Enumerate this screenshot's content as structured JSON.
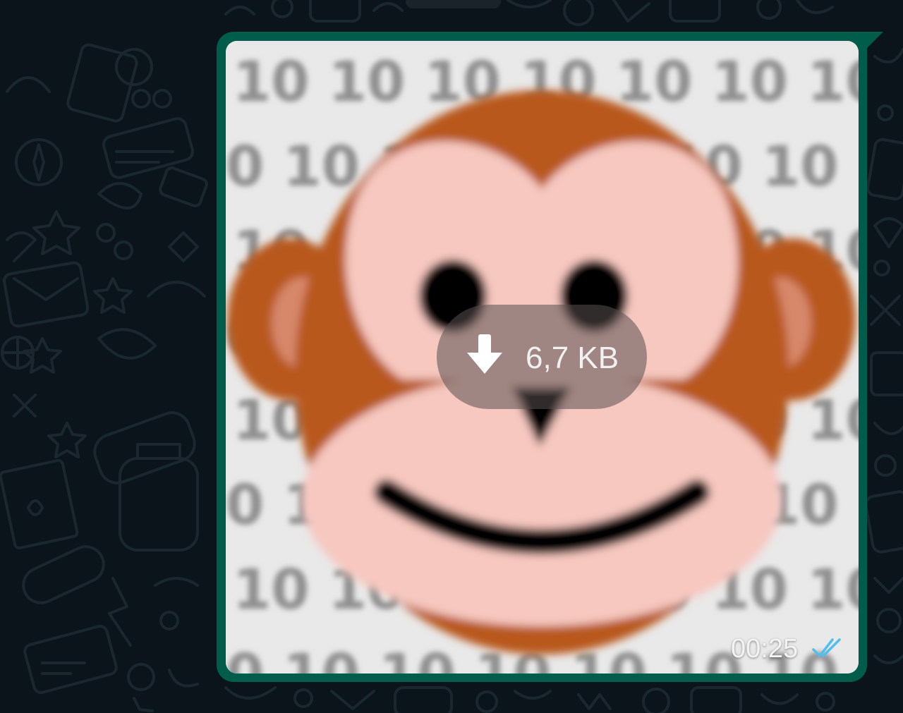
{
  "message": {
    "media_size": "6,7 KB",
    "timestamp": "00:25",
    "status_icon": "double-check-read-icon",
    "download_icon": "download-arrow-icon"
  },
  "colors": {
    "chat_background": "#0b141a",
    "bubble_outgoing": "#005c4b",
    "read_ticks": "#53bdeb",
    "monkey_fur": "#b8581c",
    "monkey_face": "#f6c8c0"
  }
}
